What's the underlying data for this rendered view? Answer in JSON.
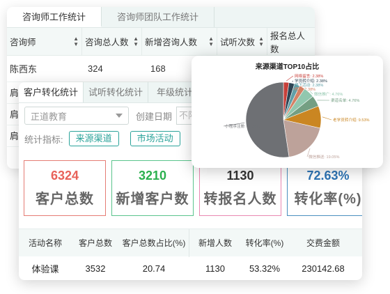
{
  "back_panel": {
    "tabs": [
      "咨询师工作统计",
      "咨询师团队工作统计"
    ],
    "columns": [
      "咨询师",
      "咨询总人数",
      "新增咨询人数",
      "试听次数",
      "报名总人数"
    ],
    "row": [
      "陈西东",
      "324",
      "168"
    ],
    "stub_rows": [
      "肩",
      "肩",
      "肩"
    ]
  },
  "front_panel": {
    "tabs": [
      "客户转化统计",
      "试听转化统计",
      "年级统计"
    ],
    "select_value": "正道教育",
    "date_label": "创建日期",
    "date_placeholder": "不限",
    "metric_label": "统计指标:",
    "metric_buttons": [
      "来源渠道",
      "市场活动"
    ],
    "cards": [
      {
        "value": "6324",
        "label": "客户总数"
      },
      {
        "value": "3210",
        "label": "新增客户数"
      },
      {
        "value": "1130",
        "label": "转报名人数"
      },
      {
        "value": "72.63%",
        "label": "转化率(%)"
      }
    ],
    "table": {
      "columns": [
        "活动名称",
        "客户总数",
        "客户总数占比(%)",
        "新增人数",
        "转化率(%)",
        "交费金额"
      ],
      "row": [
        "体验课",
        "3532",
        "20.74",
        "1130",
        "53.32%",
        "230142.68"
      ]
    }
  },
  "chart_data": {
    "type": "pie",
    "title": "来源渠道TOP10占比",
    "slices": [
      {
        "name": "网络留言",
        "value": 2.38,
        "color": "#c8403a"
      },
      {
        "name": "学员转介绍",
        "value": 2.38,
        "color": "#2f4554"
      },
      {
        "name": "线下活动",
        "value": 2.38,
        "color": "#61a0a8"
      },
      {
        "name": "拜访",
        "value": 2.38,
        "color": "#d48265"
      },
      {
        "name": "微信推广",
        "value": 4.76,
        "color": "#91c7ae"
      },
      {
        "name": "渠道名单",
        "value": 4.76,
        "color": "#749f83"
      },
      {
        "name": "老学员转介绍",
        "value": 9.53,
        "color": "#ca8622"
      },
      {
        "name": "微信推送",
        "value": 19.05,
        "color": "#bda29a"
      },
      {
        "name": "小程序注册",
        "value": 52.38,
        "color": "#6e7074"
      }
    ],
    "labels": [
      "网络留言: 2.38%",
      "学员转介绍: 2.38%",
      "线下活动: 2.38%",
      "拜访: 2.38%",
      "微信推广: 4.76%",
      "渠道名单: 4.76%",
      "老学员转介绍: 9.53%",
      "微信推送: 19.05%",
      "小程序注册: 52.38%"
    ]
  }
}
